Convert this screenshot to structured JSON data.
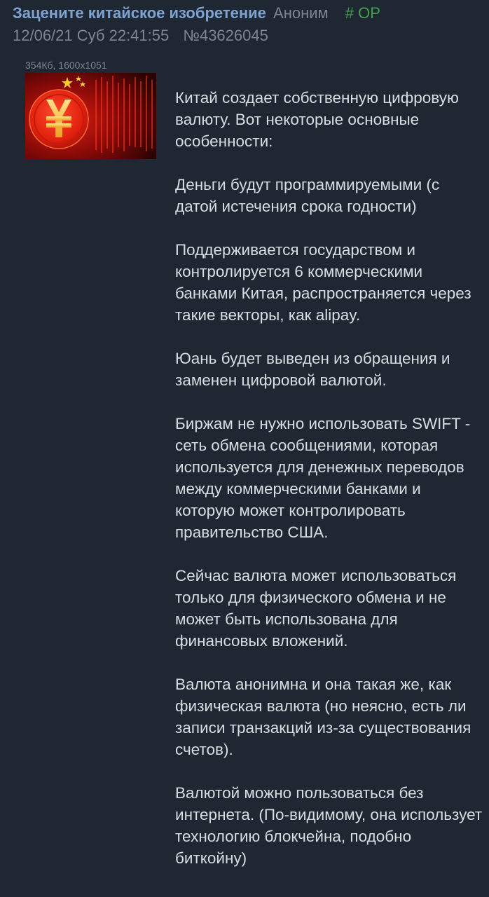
{
  "post": {
    "title": "Зацените китайское изобретение",
    "author": "Аноним",
    "op_badge": "# OP",
    "date": "12/06/21 Суб 22:41:55",
    "number": "№43626045"
  },
  "attachment": {
    "file_info": "354Кб, 1600x1051",
    "thumbnail_symbol": "¥",
    "thumbnail_icon": "yuan-coin-icon"
  },
  "body": {
    "paragraphs": [
      "Китай создает собственную цифровую валюту. Вот некоторые основные особенности:",
      "Деньги будут программируемыми (с датой истечения срока годности)",
      "Поддерживается государством и контролируется 6 коммерческими банками Китая, распространяется через такие векторы, как alipay.",
      "Юань будет выведен из обращения и заменен цифровой валютой.",
      "Биржам не нужно использовать SWIFT - сеть обмена сообщениями, которая используется для денежных переводов между коммерческими банками и которую может контролировать правительство США.",
      "Сейчас валюта может использоваться только для физического обмена и не может быть использована для финансовых вложений.",
      "Валюта анонимна и она такая же, как физическая валюта (но неясно, есть ли записи транзакций из-за существования счетов).",
      "Валютой можно пользоваться без интернета. (По-видимому, она использует технологию блокчейна, подобно биткойну)"
    ]
  },
  "colors": {
    "background": "#1e2732",
    "title": "#7ea3d0",
    "meta": "#7d8590",
    "op": "#44a04d",
    "text": "#d9dde2"
  }
}
